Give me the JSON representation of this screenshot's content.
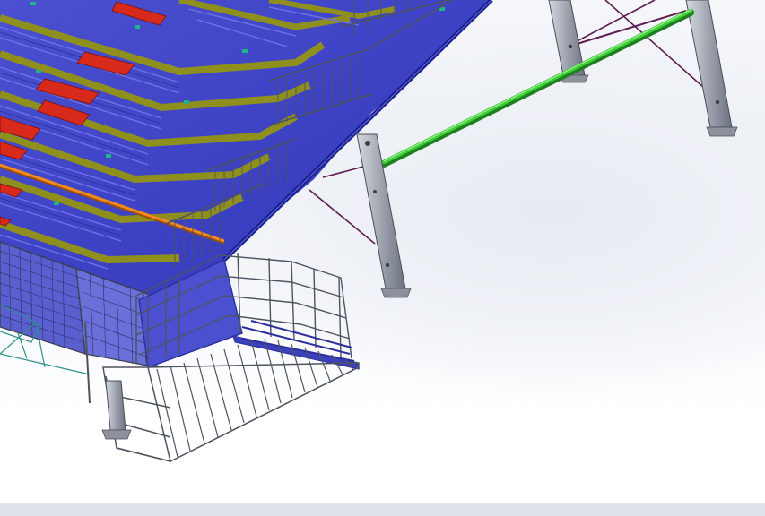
{
  "viewport": {
    "content": "cad-3d-model",
    "colors": {
      "background_top": "#f5f7fb",
      "background_bottom": "#ffffff",
      "steel_blue": "#2f35b8",
      "seat_plank": "#4b4fd0",
      "riser_olive": "#8f8f1e",
      "seat_red": "#d82a1b",
      "rail_orange": "#f28a20",
      "brace_green": "#2fb52b",
      "column_gray": "#a9adb7",
      "railing_gray": "#4e5361",
      "cross_brace_purple": "#5e1d4e"
    }
  },
  "status_bar": {
    "text": ""
  }
}
